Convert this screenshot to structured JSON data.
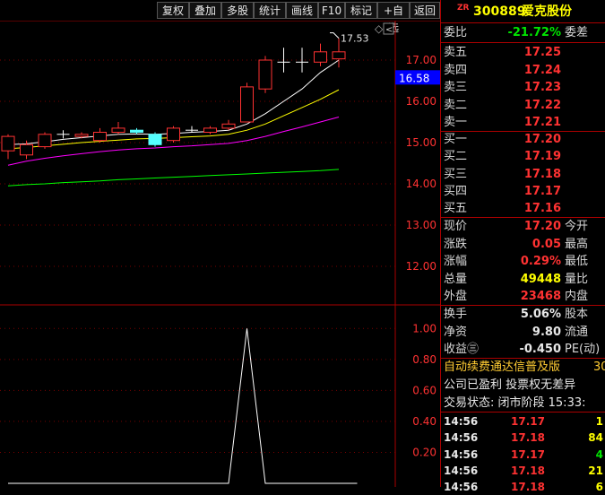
{
  "toolbar": {
    "buttons": [
      "复权",
      "叠加",
      "多股",
      "统计",
      "画线",
      "F10",
      "标记",
      "+自选",
      "返回"
    ]
  },
  "chart": {
    "price_ticks": [
      "17.00",
      "16.00",
      "15.00",
      "14.00",
      "13.00",
      "12.00"
    ],
    "current_price_tag": "16.58",
    "high_annotation": "17.53",
    "volume_ticks": [
      "1.00",
      "0.80",
      "0.60",
      "0.40",
      "0.20"
    ],
    "diamond_icon": "◇",
    "scroll_icon": "<"
  },
  "chart_data": {
    "type": "candlestick",
    "y_range": [
      11.5,
      17.8
    ],
    "candles": [
      {
        "o": 14.8,
        "c": 15.15,
        "h": 15.2,
        "l": 14.6
      },
      {
        "o": 14.7,
        "c": 14.95,
        "h": 15.05,
        "l": 14.6
      },
      {
        "o": 14.9,
        "c": 15.2,
        "h": 15.25,
        "l": 14.85
      },
      {
        "o": 15.2,
        "c": 15.2,
        "h": 15.3,
        "l": 15.1
      },
      {
        "o": 15.15,
        "c": 15.2,
        "h": 15.25,
        "l": 15.1
      },
      {
        "o": 15.05,
        "c": 15.25,
        "h": 15.35,
        "l": 15.0
      },
      {
        "o": 15.25,
        "c": 15.35,
        "h": 15.5,
        "l": 15.2
      },
      {
        "o": 15.3,
        "c": 15.25,
        "h": 15.35,
        "l": 15.2
      },
      {
        "o": 15.2,
        "c": 14.95,
        "h": 15.25,
        "l": 14.9
      },
      {
        "o": 15.05,
        "c": 15.35,
        "h": 15.4,
        "l": 15.0
      },
      {
        "o": 15.3,
        "c": 15.3,
        "h": 15.4,
        "l": 15.25
      },
      {
        "o": 15.25,
        "c": 15.35,
        "h": 15.4,
        "l": 15.2
      },
      {
        "o": 15.35,
        "c": 15.45,
        "h": 15.55,
        "l": 15.3
      },
      {
        "o": 15.5,
        "c": 16.35,
        "h": 16.45,
        "l": 15.5
      },
      {
        "o": 16.3,
        "c": 17.0,
        "h": 17.1,
        "l": 16.2
      },
      {
        "o": 16.95,
        "c": 16.95,
        "h": 17.3,
        "l": 16.7
      },
      {
        "o": 16.95,
        "c": 16.95,
        "h": 17.3,
        "l": 16.7
      },
      {
        "o": 16.95,
        "c": 17.2,
        "h": 17.4,
        "l": 16.85
      },
      {
        "o": 17.03,
        "c": 17.2,
        "h": 17.53,
        "l": 16.82
      }
    ],
    "ma_lines": [
      {
        "name": "MA5",
        "color": "#ffffff",
        "values": [
          14.95,
          14.97,
          15.02,
          15.08,
          15.12,
          15.16,
          15.2,
          15.21,
          15.2,
          15.22,
          15.25,
          15.27,
          15.3,
          15.45,
          15.7,
          16.0,
          16.3,
          16.7,
          17.0
        ]
      },
      {
        "name": "MA10",
        "color": "#ffff00",
        "values": [
          14.85,
          14.88,
          14.92,
          14.96,
          15.0,
          15.03,
          15.06,
          15.09,
          15.1,
          15.12,
          15.14,
          15.16,
          15.2,
          15.3,
          15.45,
          15.65,
          15.85,
          16.05,
          16.28
        ]
      },
      {
        "name": "MA20",
        "color": "#ff00ff",
        "values": [
          14.45,
          14.55,
          14.62,
          14.68,
          14.73,
          14.78,
          14.82,
          14.85,
          14.87,
          14.9,
          14.92,
          14.95,
          14.98,
          15.05,
          15.15,
          15.27,
          15.38,
          15.5,
          15.62
        ]
      },
      {
        "name": "MA60",
        "color": "#00ff00",
        "values": [
          13.95,
          13.98,
          14.0,
          14.03,
          14.05,
          14.07,
          14.1,
          14.12,
          14.14,
          14.16,
          14.18,
          14.2,
          14.22,
          14.24,
          14.26,
          14.28,
          14.3,
          14.32,
          14.35
        ]
      }
    ],
    "volume_line": {
      "x": [
        0,
        12,
        13,
        14,
        19
      ],
      "values": [
        0,
        0,
        1.0,
        0,
        0
      ]
    },
    "volume_range": [
      0,
      1.1
    ]
  },
  "panel": {
    "header": {
      "code": "300889",
      "name": "爱克股份",
      "badge": "ZR"
    },
    "weibi": {
      "label": "委比",
      "value": "-21.72%",
      "label2": "委差"
    },
    "sells": [
      {
        "label": "卖五",
        "price": "17.25"
      },
      {
        "label": "卖四",
        "price": "17.24"
      },
      {
        "label": "卖三",
        "price": "17.23"
      },
      {
        "label": "卖二",
        "price": "17.22"
      },
      {
        "label": "卖一",
        "price": "17.21"
      }
    ],
    "buys": [
      {
        "label": "买一",
        "price": "17.20"
      },
      {
        "label": "买二",
        "price": "17.19"
      },
      {
        "label": "买三",
        "price": "17.18"
      },
      {
        "label": "买四",
        "price": "17.17"
      },
      {
        "label": "买五",
        "price": "17.16"
      }
    ],
    "quote": [
      {
        "label": "现价",
        "value": "17.20",
        "label2": "今开",
        "color": "red"
      },
      {
        "label": "涨跌",
        "value": "0.05",
        "label2": "最高",
        "color": "red"
      },
      {
        "label": "涨幅",
        "value": "0.29%",
        "label2": "最低",
        "color": "red"
      },
      {
        "label": "总量",
        "value": "49448",
        "label2": "量比",
        "color": "yellow"
      },
      {
        "label": "外盘",
        "value": "23468",
        "label2": "内盘",
        "color": "red"
      }
    ],
    "stats": [
      {
        "label": "换手",
        "value": "5.06%",
        "label2": "股本"
      },
      {
        "label": "净资",
        "value": "9.80",
        "label2": "流通"
      },
      {
        "label": "收益㊂",
        "value": "-0.450",
        "label2": "PE(动)"
      }
    ],
    "news1": "自动续费通达信普及版",
    "news1_suffix": "30",
    "news2": "公司已盈利 投票权无差异",
    "trade_status": "交易状态: 闭市阶段 15:33:",
    "ticks": [
      {
        "time": "14:56",
        "price": "17.17",
        "vol": "1",
        "color": "yellow"
      },
      {
        "time": "14:56",
        "price": "17.18",
        "vol": "84",
        "color": "yellow"
      },
      {
        "time": "14:56",
        "price": "17.17",
        "vol": "4",
        "color": "green"
      },
      {
        "time": "14:56",
        "price": "17.18",
        "vol": "21",
        "color": "yellow"
      },
      {
        "time": "14:56",
        "price": "17.18",
        "vol": "6",
        "color": "yellow"
      }
    ]
  }
}
